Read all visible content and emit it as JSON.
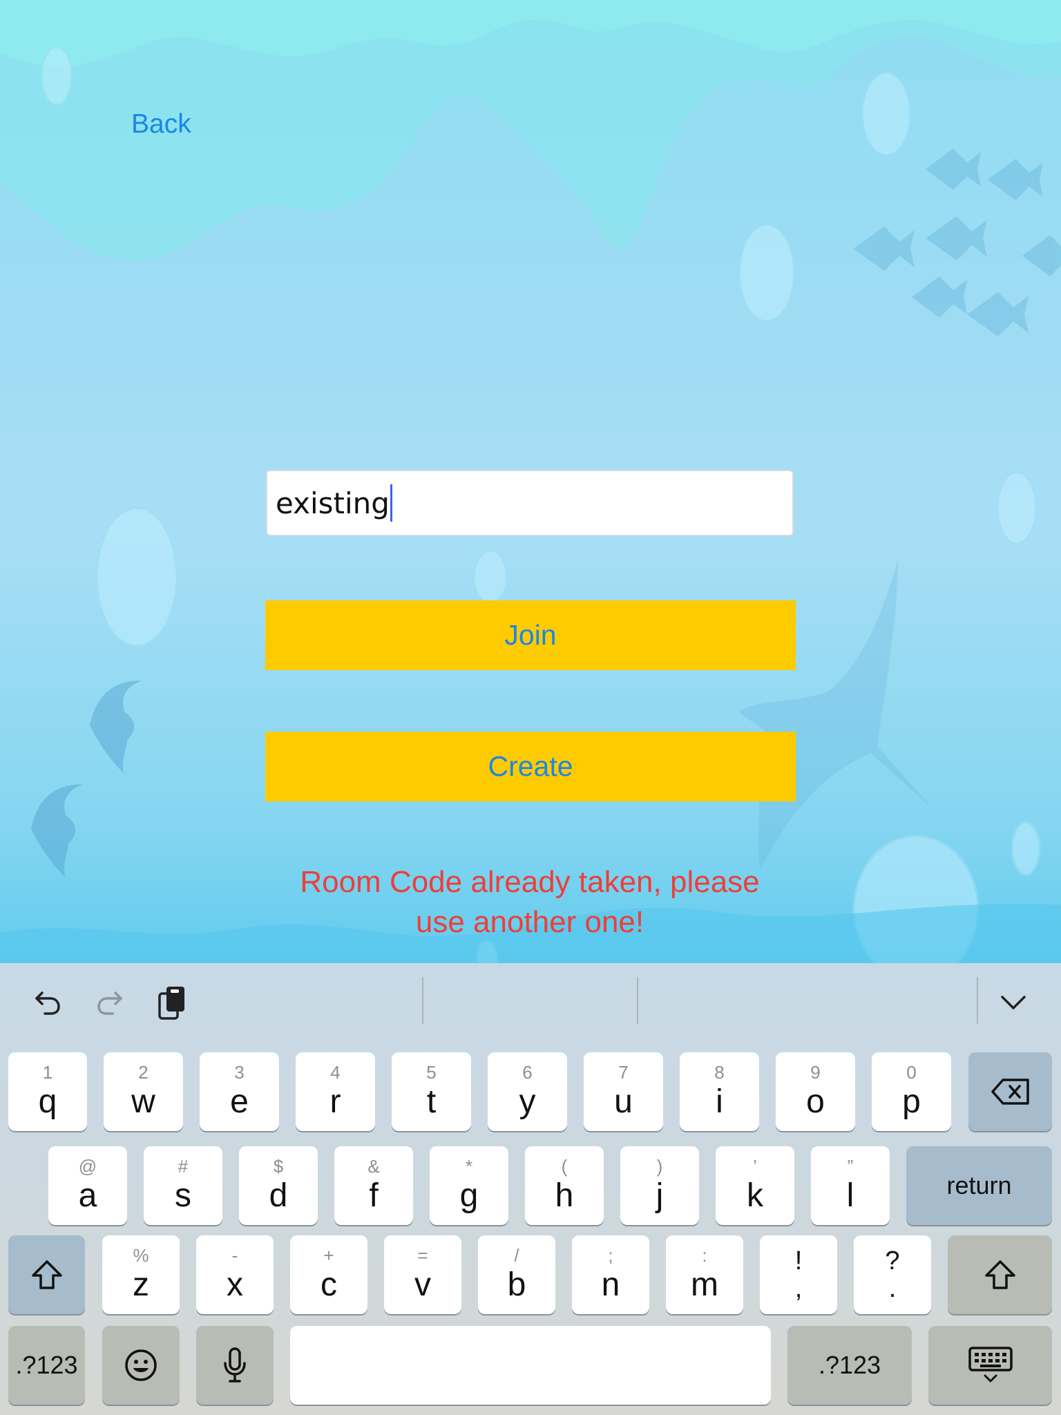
{
  "nav": {
    "back_label": "Back"
  },
  "room_code": {
    "value": "existing"
  },
  "buttons": {
    "join_label": "Join",
    "create_label": "Create"
  },
  "error": {
    "line1": "Room Code already taken, please",
    "line2": "use another one!"
  },
  "colors": {
    "button_bg": "#fecb00",
    "button_text": "#1a87e6",
    "error_text": "#ee3f37",
    "link": "#1a87e6"
  },
  "keyboard": {
    "toolbar_icons": [
      "undo-icon",
      "redo-icon",
      "clipboard-icon",
      "chevron-down-icon"
    ],
    "row1": [
      {
        "main": "q",
        "sub": "1"
      },
      {
        "main": "w",
        "sub": "2"
      },
      {
        "main": "e",
        "sub": "3"
      },
      {
        "main": "r",
        "sub": "4"
      },
      {
        "main": "t",
        "sub": "5"
      },
      {
        "main": "y",
        "sub": "6"
      },
      {
        "main": "u",
        "sub": "7"
      },
      {
        "main": "i",
        "sub": "8"
      },
      {
        "main": "o",
        "sub": "9"
      },
      {
        "main": "p",
        "sub": "0"
      }
    ],
    "row2": [
      {
        "main": "a",
        "sub": "@"
      },
      {
        "main": "s",
        "sub": "#"
      },
      {
        "main": "d",
        "sub": "$"
      },
      {
        "main": "f",
        "sub": "&"
      },
      {
        "main": "g",
        "sub": "*"
      },
      {
        "main": "h",
        "sub": "("
      },
      {
        "main": "j",
        "sub": ")"
      },
      {
        "main": "k",
        "sub": "’"
      },
      {
        "main": "l",
        "sub": "”"
      }
    ],
    "row3": [
      {
        "main": "z",
        "sub": "%"
      },
      {
        "main": "x",
        "sub": "-"
      },
      {
        "main": "c",
        "sub": "+"
      },
      {
        "main": "v",
        "sub": "="
      },
      {
        "main": "b",
        "sub": "/"
      },
      {
        "main": "n",
        "sub": ";"
      },
      {
        "main": "m",
        "sub": ":"
      }
    ],
    "row3_symbols": [
      {
        "top": "!",
        "bottom": ","
      },
      {
        "top": "?",
        "bottom": "."
      }
    ],
    "return_label": "return",
    "numbers_label": ".?123"
  }
}
